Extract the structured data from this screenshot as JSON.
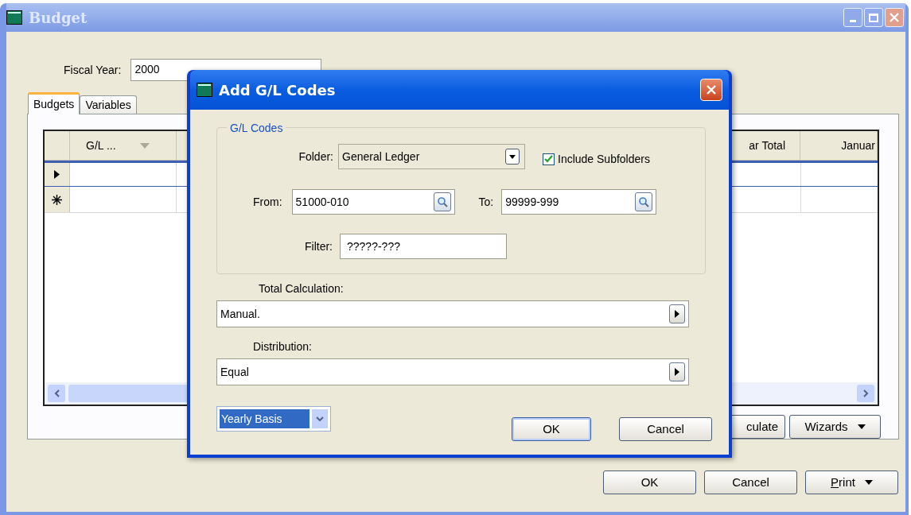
{
  "window": {
    "title": "Budget",
    "active": false
  },
  "fiscal_year": {
    "label": "Fiscal Year:",
    "value": "2000"
  },
  "tabs": [
    {
      "label": "Budgets",
      "selected": true
    },
    {
      "label": "Variables",
      "selected": false
    }
  ],
  "grid": {
    "columns": [
      {
        "label": "G/L ...",
        "sortable": true
      },
      {
        "label": "ar Total",
        "sortable": false
      },
      {
        "label": "Januar",
        "sortable": false
      }
    ],
    "rows": [
      {
        "kind": "current",
        "selected": true
      },
      {
        "kind": "new",
        "selected": false
      }
    ]
  },
  "panel_buttons": [
    {
      "label": "culate",
      "menu": false
    },
    {
      "label": "Wizards",
      "menu": true
    }
  ],
  "buttons": [
    {
      "label": "OK",
      "menu": false,
      "mnemonic": false
    },
    {
      "label": "Cancel",
      "menu": false,
      "mnemonic": false
    },
    {
      "label": "Print",
      "menu": true,
      "mnemonic": true
    }
  ],
  "dialog": {
    "title": "Add G/L Codes",
    "group": "G/L Codes",
    "folder": {
      "label": "Folder:",
      "value": "General Ledger"
    },
    "include_subfolders": {
      "label": "Include Subfolders",
      "checked": true
    },
    "from": {
      "label": "From:",
      "value": "51000-010"
    },
    "to": {
      "label": "To:",
      "value": "99999-999"
    },
    "filter": {
      "label": "Filter:",
      "value": "?????-???"
    },
    "total_calculation": {
      "label": "Total Calculation:",
      "value": "Manual."
    },
    "distribution": {
      "label": "Distribution:",
      "value": "Equal"
    },
    "basis": {
      "value": "Yearly Basis",
      "selected": true
    },
    "buttons": [
      {
        "label": "OK",
        "default": true
      },
      {
        "label": "Cancel",
        "default": false
      }
    ]
  }
}
